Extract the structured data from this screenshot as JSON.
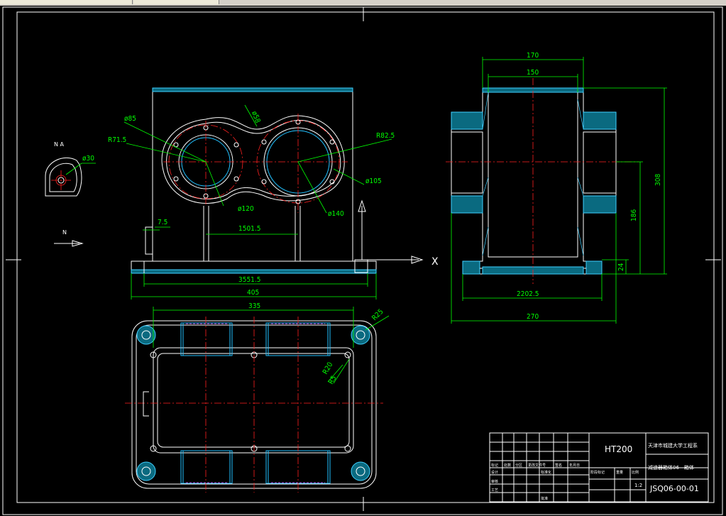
{
  "dims": {
    "d85": "ø85",
    "r71_5": "R71.5",
    "d58": "ø58",
    "r82_5": "R82.5",
    "d105": "ø105",
    "d120": "ø120",
    "d140": "ø140",
    "d30": "ø30",
    "d7_5": "7.5",
    "d150_front": "1501.5",
    "d355": "3551.5",
    "d405": "405",
    "d335": "335",
    "r25": "R25",
    "r20": "R20",
    "r5": "R5",
    "d170": "170",
    "d150_side": "150",
    "d308": "308",
    "d186": "186",
    "d24": "24",
    "d220": "2202.5",
    "d270": "270"
  },
  "labels": {
    "view_a": "N  A",
    "arrow_n": "N",
    "axis_x": "X"
  },
  "title_block": {
    "material": "HT200",
    "company": "天津市城建大学工程系",
    "part_name": "减速器箱体06 - 箱体",
    "drawing_no": "JSQ06-00-01",
    "col1": "标记",
    "col2": "处数",
    "col3": "分区",
    "col4": "更改文件号",
    "col5": "签名",
    "col6": "年月日",
    "r_design": "设计",
    "r_check": "审核",
    "r_process": "工艺",
    "r_std": "标准化",
    "r_approve": "批准",
    "stage": "阶段标记",
    "weight": "重量",
    "scale": "比例",
    "sheet": "1:2"
  }
}
